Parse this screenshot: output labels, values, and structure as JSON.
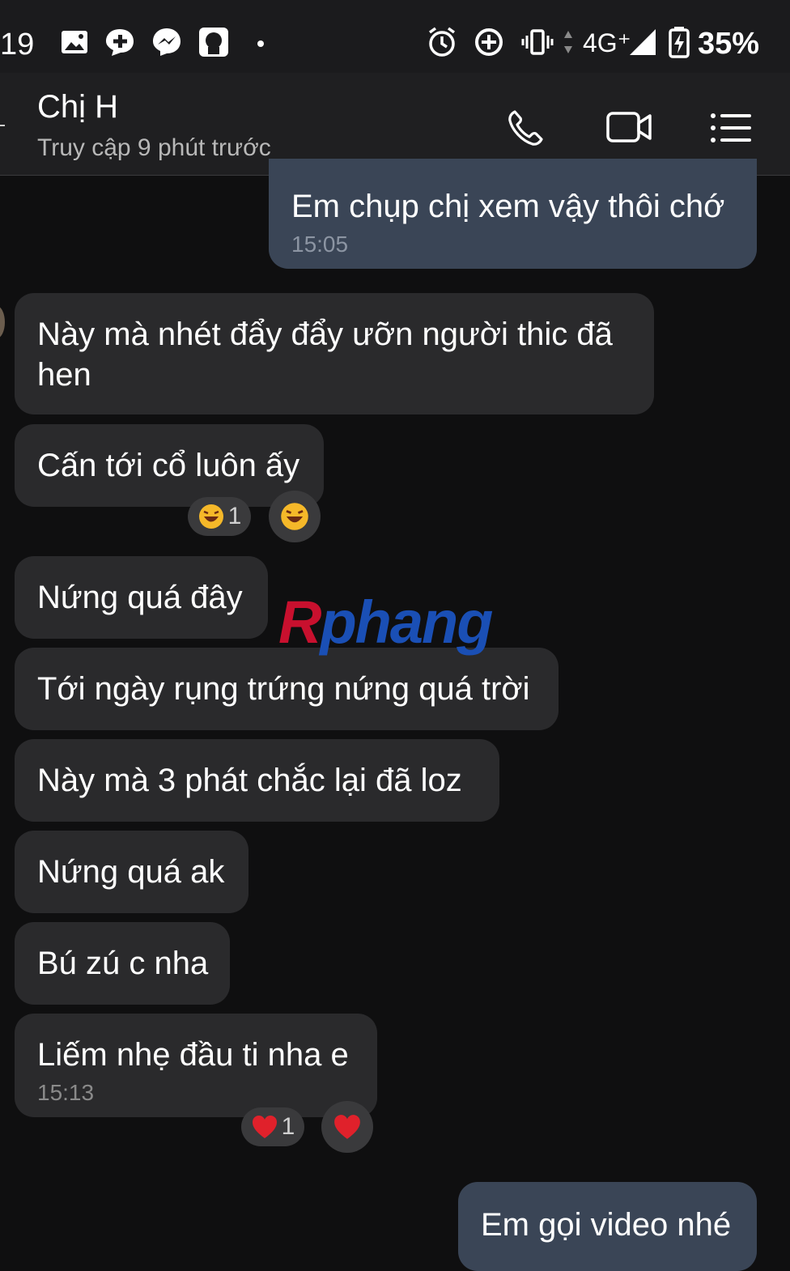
{
  "status_bar": {
    "time": "19",
    "network": "4G⁺",
    "battery": "35%"
  },
  "header": {
    "contact_name": "Chị H",
    "contact_status": "Truy cập 9 phút trước",
    "call_icon": "phone-icon",
    "video_icon": "video-camera-icon",
    "menu_icon": "list-menu-icon"
  },
  "messages": [
    {
      "dir": "out",
      "text": "Em chụp chị xem vậy thôi chớ",
      "time": "15:05"
    },
    {
      "dir": "in",
      "text": "Này mà nhét đẩy đẩy ưỡn người thic đã",
      "text2": "hen"
    },
    {
      "dir": "in",
      "text": "Cấn tới cổ luôn ấy",
      "reaction": {
        "icon": "laughing-emoji",
        "count": "1"
      }
    },
    {
      "dir": "in",
      "text": "Nứng quá đây"
    },
    {
      "dir": "in",
      "text": "Tới ngày rụng trứng nứng quá trời"
    },
    {
      "dir": "in",
      "text": "Này mà 3 phát chắc lại đã loz"
    },
    {
      "dir": "in",
      "text": "Nứng quá ak"
    },
    {
      "dir": "in",
      "text": "Bú zú c nha"
    },
    {
      "dir": "in",
      "text": "Liếm nhẹ đầu ti nha e",
      "time": "15:13",
      "reaction": {
        "icon": "heart-emoji",
        "count": "1"
      }
    },
    {
      "dir": "out",
      "text": "Em gọi video nhé"
    }
  ],
  "watermark": {
    "part1": "R",
    "part2": "phang"
  },
  "colors": {
    "background": "#0f0f10",
    "incoming_bubble": "#2a2a2c",
    "outgoing_bubble": "#3a4556",
    "header": "#1f1f21"
  }
}
